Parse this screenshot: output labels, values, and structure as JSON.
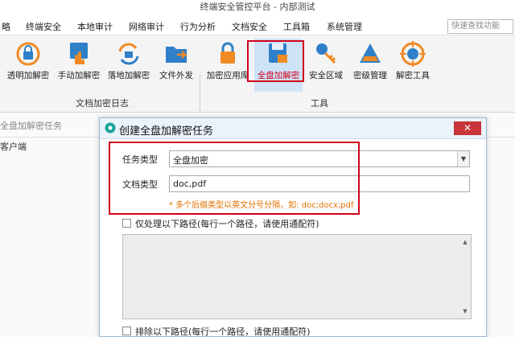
{
  "window": {
    "title": "终端安全管控平台 - 内部测试"
  },
  "menu": {
    "items": [
      "略",
      "终端安全",
      "本地审计",
      "网络审计",
      "行为分析",
      "文档安全",
      "工具箱",
      "系统管理"
    ],
    "search_placeholder": "快速查找功能"
  },
  "ribbon": {
    "group1": {
      "label": "文档加密日志",
      "buttons": [
        "透明加解密",
        "手动加解密",
        "落地加解密",
        "文件外发"
      ]
    },
    "group2": {
      "label": "工具",
      "buttons": [
        "加密应用库",
        "全盘加解密",
        "安全区域",
        "密级管理",
        "解密工具"
      ],
      "active_index": 1
    }
  },
  "workspace": {
    "title": "全盘加解密任务",
    "column_client": "客户端"
  },
  "dialog": {
    "title": "创建全盘加解密任务",
    "close_symbol": "✕",
    "task_type_label": "任务类型",
    "task_type_value": "全盘加密",
    "doc_type_label": "文档类型",
    "doc_type_value": "doc,pdf",
    "hint": "* 多个后缀类型以英文分号分隔，如: doc;docx;pdf",
    "only_paths_label": "仅处理以下路径(每行一个路径，请使用通配符)",
    "exclude_paths_label": "排除以下路径(每行一个路径，请使用通配符)"
  },
  "colors": {
    "accent_red": "#d0021b",
    "hint_orange": "#e07000",
    "active_blue": "#cfe3f7"
  }
}
